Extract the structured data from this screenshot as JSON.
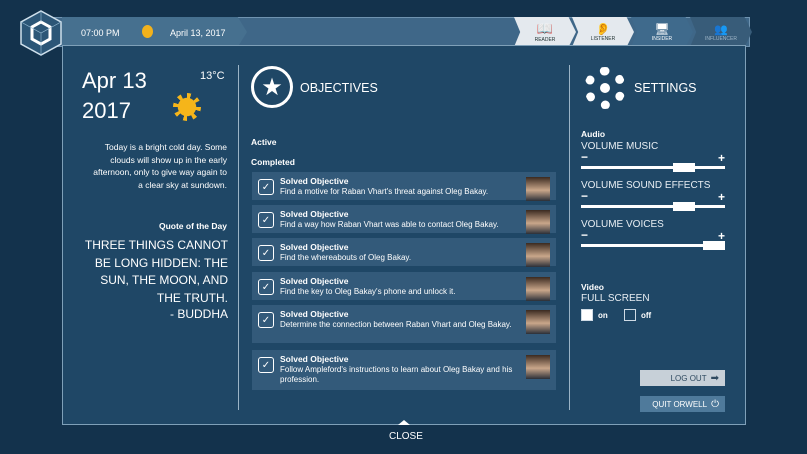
{
  "header": {
    "time": "07:00 PM",
    "date": "April 13, 2017",
    "tabs": [
      {
        "label": "READER"
      },
      {
        "label": "LISTENER"
      },
      {
        "label": "INSIDER"
      },
      {
        "label": "INFLUENCER"
      }
    ]
  },
  "day": {
    "date_line1": "Apr 13",
    "date_line2": "2017",
    "temperature": "13°C",
    "description": "Today is a bright cold day. Some clouds will show up in the early afternoon, only to give way again to a clear sky at sundown.",
    "quote_label": "Quote of the Day",
    "quote": "THREE THINGS CANNOT BE LONG HIDDEN: THE SUN, THE MOON, AND THE TRUTH.",
    "quote_author": "- BUDDHA"
  },
  "objectives": {
    "title": "OBJECTIVES",
    "active_label": "Active",
    "completed_label": "Completed",
    "items": [
      {
        "status": "Solved Objective",
        "text": "Find a motive for Raban Vhart's threat against Oleg Bakay."
      },
      {
        "status": "Solved Objective",
        "text": "Find a way how Raban Vhart was able to contact Oleg Bakay."
      },
      {
        "status": "Solved Objective",
        "text": "Find the whereabouts of Oleg Bakay."
      },
      {
        "status": "Solved Objective",
        "text": "Find the key to Oleg Bakay's phone and unlock it."
      },
      {
        "status": "Solved Objective",
        "text": "Determine the connection between Raban Vhart and Oleg Bakay."
      },
      {
        "status": "Solved Objective",
        "text": "Follow Ampleford's instructions to learn about Oleg Bakay and his profession."
      }
    ]
  },
  "settings": {
    "title": "SETTINGS",
    "audio_label": "Audio",
    "music_label": "VOLUME MUSIC",
    "music_value": 0.75,
    "sfx_label": "VOLUME SOUND EFFECTS",
    "sfx_value": 0.75,
    "voices_label": "VOLUME VOICES",
    "voices_value": 1.0,
    "minus": "−",
    "plus": "+",
    "video_label": "Video",
    "fullscreen_label": "FULL SCREEN",
    "on_label": "on",
    "off_label": "off",
    "fullscreen": "on",
    "logout_label": "LOG OUT",
    "quit_label": "QUIT ORWELL"
  },
  "footer": {
    "close_label": "CLOSE"
  }
}
